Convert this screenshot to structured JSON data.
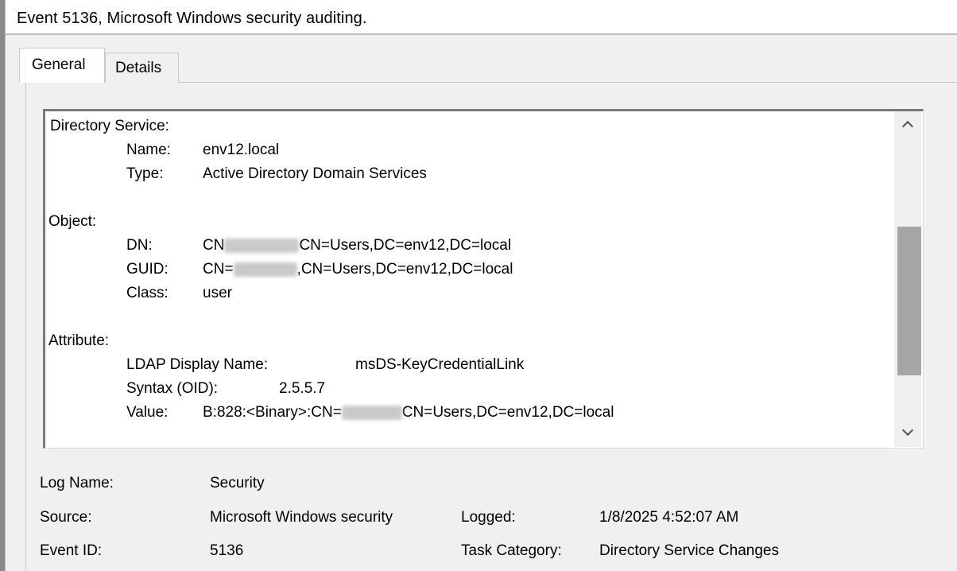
{
  "window": {
    "title": "Event 5136, Microsoft Windows security auditing."
  },
  "tabs": [
    {
      "label": "General",
      "selected": true
    },
    {
      "label": "Details",
      "selected": false
    }
  ],
  "description": {
    "directory_service_heading": "Directory Service:",
    "ds_name_label": "Name:",
    "ds_name_value": "env12.local",
    "ds_type_label": "Type:",
    "ds_type_value": "Active Directory Domain Services",
    "object_heading": "Object:",
    "dn_label": "DN:",
    "dn_prefix": "CN",
    "dn_suffix": "CN=Users,DC=env12,DC=local",
    "guid_label": "GUID:",
    "guid_prefix": "CN=",
    "guid_suffix": ",CN=Users,DC=env12,DC=local",
    "class_label": "Class:",
    "class_value": "user",
    "attribute_heading": "Attribute:",
    "ldap_label": "LDAP Display Name:",
    "ldap_value": "msDS-KeyCredentialLink",
    "syntax_label": "Syntax (OID):",
    "syntax_value": "2.5.5.7",
    "value_label": "Value:",
    "value_prefix": "B:828:<Binary>:CN=",
    "value_suffix": "CN=Users,DC=env12,DC=local"
  },
  "properties": {
    "log_name_label": "Log Name:",
    "log_name_value": "Security",
    "source_label": "Source:",
    "source_value": "Microsoft Windows security",
    "logged_label": "Logged:",
    "logged_value": "1/8/2025 4:52:07 AM",
    "event_id_label": "Event ID:",
    "event_id_value": "5136",
    "task_category_label": "Task Category:",
    "task_category_value": "Directory Service Changes"
  },
  "icons": {
    "scroll_up": "chevron-up-icon",
    "scroll_down": "chevron-down-icon"
  }
}
